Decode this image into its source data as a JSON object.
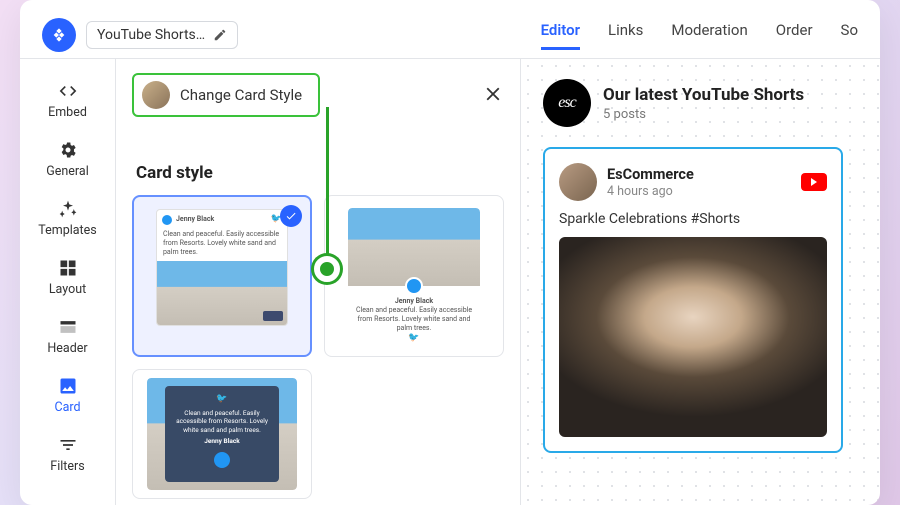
{
  "header": {
    "widget_title": "YouTube Shorts…",
    "tabs": [
      "Editor",
      "Links",
      "Moderation",
      "Order",
      "So"
    ]
  },
  "sidebar": {
    "items": [
      {
        "label": "Embed"
      },
      {
        "label": "General"
      },
      {
        "label": "Templates"
      },
      {
        "label": "Layout"
      },
      {
        "label": "Header"
      },
      {
        "label": "Card",
        "active": true
      },
      {
        "label": "Filters"
      }
    ]
  },
  "panel": {
    "change_label": "Change Card Style",
    "section_title": "Card style",
    "thumb_author": "Jenny Black",
    "thumb_text": "Clean and peaceful. Easily accessible from Resorts. Lovely white sand and palm trees."
  },
  "preview": {
    "logo_text": "esc",
    "title": "Our latest YouTube Shorts",
    "subtitle": "5 posts",
    "card": {
      "author": "EsCommerce",
      "time": "4 hours ago",
      "caption": "Sparkle Celebrations #Shorts"
    }
  }
}
